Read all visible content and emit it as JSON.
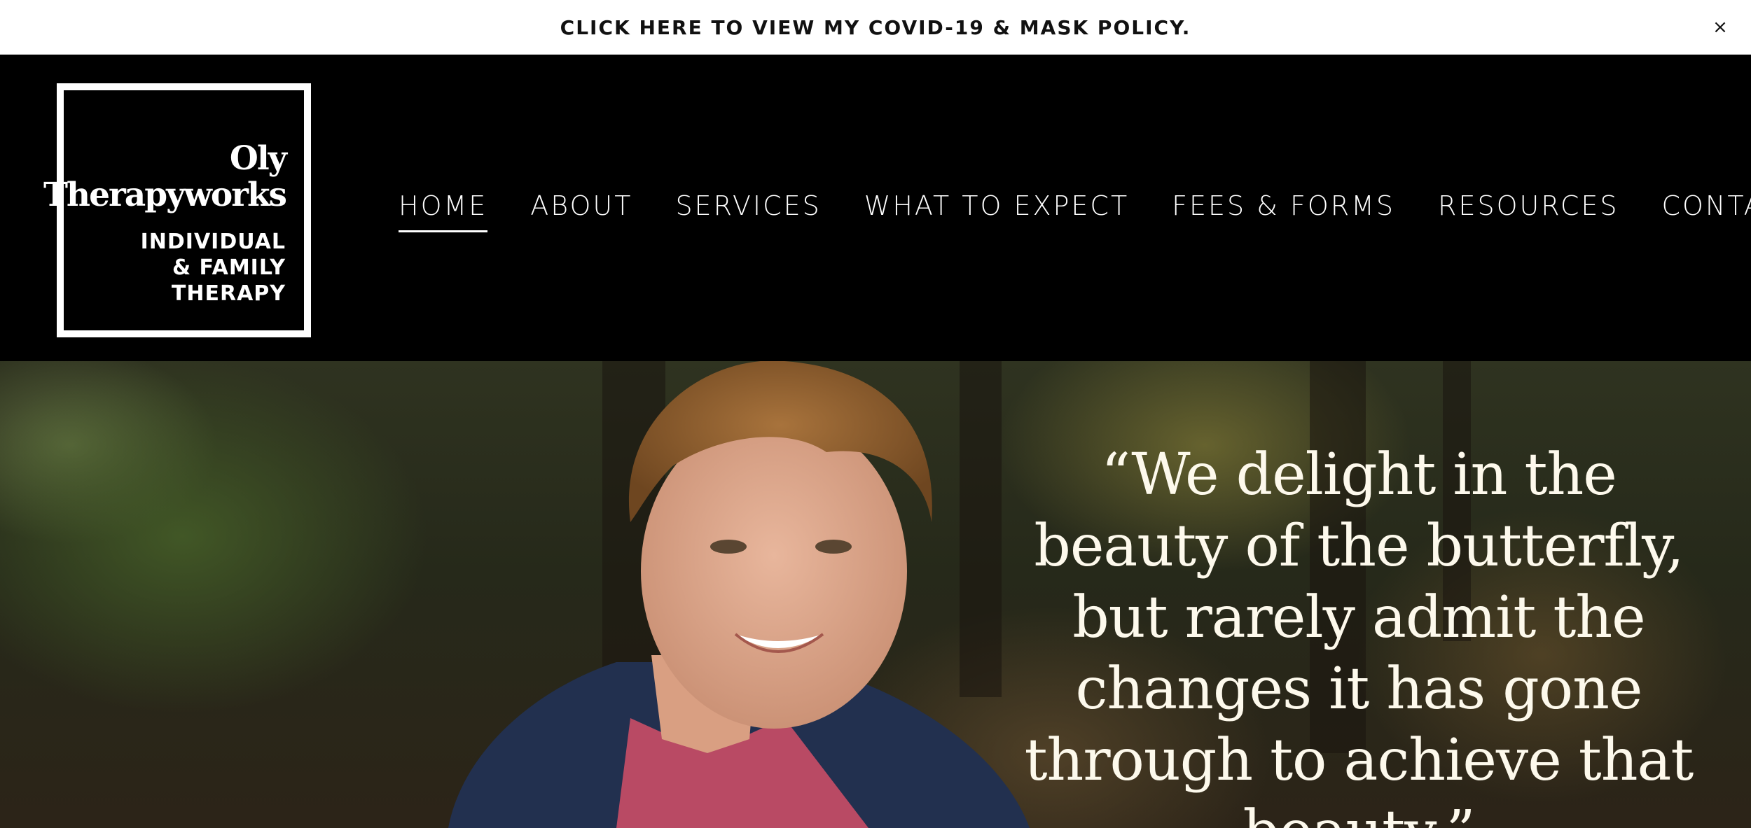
{
  "announcement": {
    "text": "CLICK HERE TO VIEW MY COVID-19 & MASK POLICY.",
    "close_icon": "×"
  },
  "logo": {
    "name_line1": "Oly",
    "name_line2": "Therapyworks",
    "tagline": "INDIVIDUAL\n& FAMILY\nTHERAPY"
  },
  "nav": {
    "items": [
      {
        "label": "HOME",
        "active": true
      },
      {
        "label": "ABOUT",
        "active": false
      },
      {
        "label": "SERVICES",
        "active": false
      },
      {
        "label": "WHAT TO EXPECT",
        "active": false
      },
      {
        "label": "FEES & FORMS",
        "active": false
      },
      {
        "label": "RESOURCES",
        "active": false
      },
      {
        "label": "CONTACT",
        "active": false
      }
    ]
  },
  "hero": {
    "quote": "“We delight in the beauty of the butterfly, but rarely admit the changes it has gone through to achieve that beauty.”"
  },
  "colors": {
    "announcement_bg": "#ffffff",
    "header_bg": "#000000",
    "text_light": "#ffffff",
    "quote_text": "#fdf9ec"
  }
}
